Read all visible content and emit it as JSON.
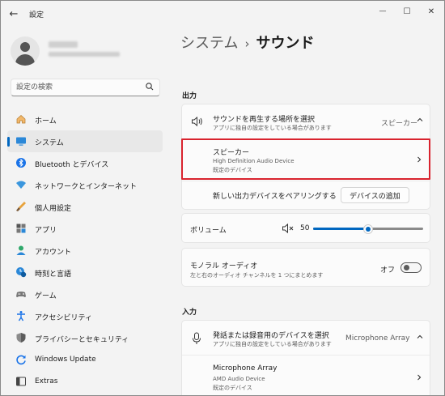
{
  "window": {
    "app_title": "設定",
    "back_glyph": "←",
    "minimize_glyph": "—",
    "maximize_glyph": "☐",
    "close_glyph": "✕"
  },
  "profile": {
    "avatar_icon": "person-icon"
  },
  "search": {
    "placeholder": "設定の検索",
    "icon": "search-icon"
  },
  "nav": {
    "items": [
      {
        "label": "ホーム",
        "icon": "home-icon",
        "selected": false
      },
      {
        "label": "システム",
        "icon": "system-icon",
        "selected": true
      },
      {
        "label": "Bluetooth とデバイス",
        "icon": "bluetooth-icon",
        "selected": false
      },
      {
        "label": "ネットワークとインターネット",
        "icon": "network-icon",
        "selected": false
      },
      {
        "label": "個人用設定",
        "icon": "brush-icon",
        "selected": false
      },
      {
        "label": "アプリ",
        "icon": "apps-icon",
        "selected": false
      },
      {
        "label": "アカウント",
        "icon": "account-icon",
        "selected": false
      },
      {
        "label": "時刻と言語",
        "icon": "clock-globe-icon",
        "selected": false
      },
      {
        "label": "ゲーム",
        "icon": "game-icon",
        "selected": false
      },
      {
        "label": "アクセシビリティ",
        "icon": "accessibility-icon",
        "selected": false
      },
      {
        "label": "プライバシーとセキュリティ",
        "icon": "shield-icon",
        "selected": false
      },
      {
        "label": "Windows Update",
        "icon": "update-icon",
        "selected": false
      },
      {
        "label": "Extras",
        "icon": "extras-icon",
        "selected": false
      }
    ]
  },
  "breadcrumb": {
    "parent": "システム",
    "separator": "›",
    "current": "サウンド"
  },
  "output": {
    "section_label": "出力",
    "choose_row": {
      "title": "サウンドを再生する場所を選択",
      "subtitle": "アプリに独自の設定をしている場合があります",
      "value": "スピーカー"
    },
    "device_row": {
      "title": "スピーカー",
      "line2": "High Definition Audio Device",
      "line3": "既定のデバイス"
    },
    "pair_row": {
      "title": "新しい出力デバイスをペアリングする",
      "button": "デバイスの追加"
    },
    "volume": {
      "label": "ボリューム",
      "value": "50",
      "level": 0.5
    },
    "mono": {
      "title": "モノラル オーディオ",
      "subtitle": "左と右のオーディオ チャンネルを 1 つにまとめます",
      "state": "オフ"
    }
  },
  "input": {
    "section_label": "入力",
    "choose_row": {
      "title": "発話または録音用のデバイスを選択",
      "subtitle": "アプリに独自の設定をしている場合があります",
      "value": "Microphone Array"
    },
    "device_row": {
      "title": "Microphone Array",
      "line2": "AMD Audio Device",
      "line3": "既定のデバイス"
    }
  },
  "colors": {
    "accent": "#0067c0",
    "highlight": "#d9232e"
  }
}
